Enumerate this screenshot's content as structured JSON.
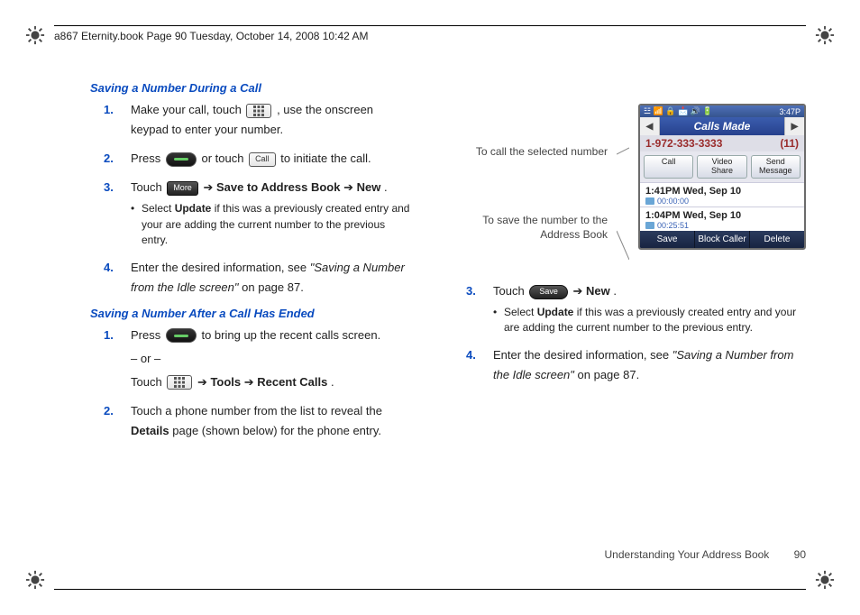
{
  "header": {
    "running_head": "a867 Eternity.book  Page 90  Tuesday, October 14, 2008  10:42 AM"
  },
  "section1": {
    "heading": "Saving a Number During a Call",
    "steps": {
      "s1a": "Make your call, touch ",
      "s1b": ", use the onscreen keypad to enter your number.",
      "s2a": "Press ",
      "s2b": " or touch ",
      "s2c": " to initiate the call.",
      "icon_dial": "Dial",
      "icon_call": "Call",
      "s3a": "Touch ",
      "icon_more": "More",
      "s3b": " ➔ ",
      "s3_bold1": "Save to Address Book",
      "s3c": " ➔ ",
      "s3_bold2": "New",
      "s3d": ".",
      "sub1a": "Select ",
      "sub1_bold": "Update",
      "sub1b": " if this was a previously created entry and your are adding the current number to the previous entry.",
      "s4a": "Enter the desired information, see ",
      "s4_ref": "\"Saving a Number from the Idle screen\"",
      "s4b": " on page 87."
    }
  },
  "section2": {
    "heading": "Saving a Number After a Call Has Ended",
    "steps": {
      "s1a": "Press ",
      "s1b": " to bring up the recent calls screen.",
      "or": "– or –",
      "s1c": "Touch ",
      "icon_menu": "Menu",
      "s1d": " ➔ ",
      "s1_bold1": "Tools",
      "s1e": " ➔ ",
      "s1_bold2": "Recent Calls",
      "s1f": ".",
      "s2a": "Touch a phone number from the list to reveal the ",
      "s2_bold": "Details",
      "s2b": " page (shown below) for the phone entry."
    }
  },
  "figure": {
    "callout1": "To call the selected number",
    "callout2": "To save the number to the Address Book",
    "phone": {
      "status_left": "☳ 📶 🔒 📩 🔊 🔋",
      "status_right": "3:47P",
      "tab_title": "Calls Made",
      "number": "1-972-333-3333",
      "count": "(11)",
      "btn_call": "Call",
      "btn_video": "Video\nShare",
      "btn_msg": "Send\nMessage",
      "e1_time": "1:41PM Wed, Sep 10",
      "e1_dur": "00:00:00",
      "e2_time": "1:04PM Wed, Sep 10",
      "e2_dur": "00:25:51",
      "sk_save": "Save",
      "sk_block": "Block Caller",
      "sk_delete": "Delete"
    }
  },
  "rightsteps": {
    "s3a": "Touch ",
    "icon_save": "Save",
    "s3b": " ➔ ",
    "s3_bold": "New",
    "s3c": ".",
    "sub1a": "Select ",
    "sub1_bold": "Update",
    "sub1b": " if this was a previously created entry and your are adding the current number to the previous entry.",
    "s4a": "Enter the desired information, see ",
    "s4_ref": "\"Saving a Number from the Idle screen\"",
    "s4b": " on page 87."
  },
  "footer": {
    "section_title": "Understanding Your Address Book",
    "page_number": "90"
  }
}
